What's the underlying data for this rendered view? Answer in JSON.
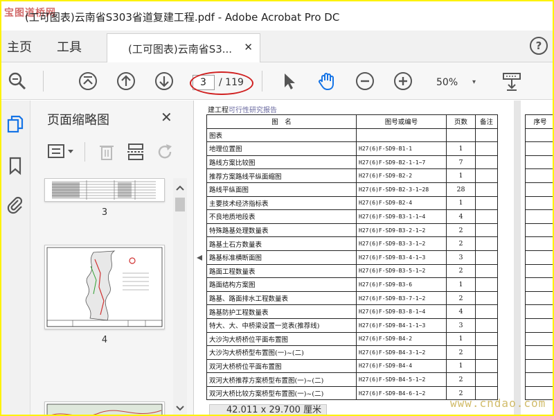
{
  "window": {
    "logo_text": "宝图道桥网",
    "title": "(工可图表)云南省S303省道复建工程.pdf - Adobe Acrobat Pro DC"
  },
  "menu": {
    "home": "主页",
    "tools": "工具",
    "doc_tab_label": "(工可图表)云南省S3...",
    "doc_tab_close": "✕",
    "help": "?"
  },
  "toolbar": {
    "current_page": "3",
    "page_total": "/ 119",
    "zoom": "50%",
    "zoom_caret": "▾"
  },
  "thumbnails": {
    "title": "页面缩略图",
    "close": "✕",
    "pages": [
      {
        "number": "3"
      },
      {
        "number": "4"
      }
    ]
  },
  "document": {
    "header_main": "建工程",
    "header_sub": "可行性研究报告",
    "columns": [
      "图　名",
      "图号或编号",
      "页数",
      "备注"
    ],
    "right_columns": [
      "序号"
    ],
    "rows": [
      {
        "name": "图表",
        "code": "",
        "pages": ""
      },
      {
        "name": "地理位置图",
        "code": "H27(6)F-SD9-B1-1",
        "pages": "1"
      },
      {
        "name": "路线方案比较图",
        "code": "H27(6)F-SD9-B2-1-1~7",
        "pages": "7"
      },
      {
        "name": "推荐方案路线平纵面缩图",
        "code": "H27(6)F-SD9-B2-2",
        "pages": "1"
      },
      {
        "name": "路线平纵面图",
        "code": "H27(6)F-SD9-B2-3-1~28",
        "pages": "28"
      },
      {
        "name": "主要技术经济指标表",
        "code": "H27(6)F-SD9-B2-4",
        "pages": "1"
      },
      {
        "name": "不良地质地段表",
        "code": "H27(6)F-SD9-B3-1-1~4",
        "pages": "4"
      },
      {
        "name": "特殊路基处理数量表",
        "code": "H27(6)F-SD9-B3-2-1~2",
        "pages": "2"
      },
      {
        "name": "路基土石方数量表",
        "code": "H27(6)F-SD9-B3-3-1~2",
        "pages": "2"
      },
      {
        "name": "路基标准横断面图",
        "code": "H27(6)F-SD9-B3-4-1~3",
        "pages": "3"
      },
      {
        "name": "路面工程数量表",
        "code": "H27(6)F-SD9-B3-5-1~2",
        "pages": "2"
      },
      {
        "name": "路面结构方案图",
        "code": "H27(6)F-SD9-B3-6",
        "pages": "1"
      },
      {
        "name": "路基、路面排水工程数量表",
        "code": "H27(6)F-SD9-B3-7-1~2",
        "pages": "2"
      },
      {
        "name": "路基防护工程数量表",
        "code": "H27(6)F-SD9-B3-8-1~4",
        "pages": "4"
      },
      {
        "name": "特大、大、中桥梁设置一览表(推荐线)",
        "code": "H27(6)F-SD9-B4-1-1~3",
        "pages": "3"
      },
      {
        "name": "大沙沟大桥桥位平面布置图",
        "code": "H27(6)F-SD9-B4-2",
        "pages": "1"
      },
      {
        "name": "大沙沟大桥桥型布置图(一)~(二)",
        "code": "H27(6)F-SD9-B4-3-1~2",
        "pages": "2"
      },
      {
        "name": "双河大桥桥位平面布置图",
        "code": "H27(6)F-SD9-B4-4",
        "pages": "1"
      },
      {
        "name": "双河大桥推荐方案桥型布置图(一)~(二)",
        "code": "H27(6)F-SD9-B4-5-1~2",
        "pages": "2"
      },
      {
        "name": "双河大桥比较方案桥型布置图(一)~(二)",
        "code": "H27(6)F-SD9-B4-6-1~2",
        "pages": "2"
      }
    ],
    "page_size": "42.011 x 29.700 厘米"
  },
  "watermark": "www.cndao.com",
  "colors": {
    "border_yellow": "#fdf200",
    "highlight_red": "#d02020",
    "icon_blue": "#1473e6"
  }
}
